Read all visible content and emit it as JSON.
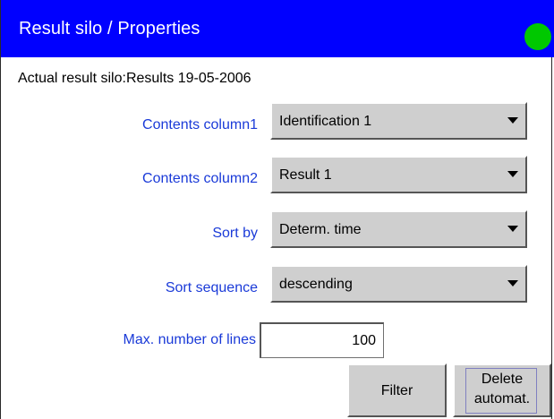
{
  "window": {
    "title": "Result silo / Properties",
    "status_color": "#00c800"
  },
  "actual_result_silo": "Actual result silo:Results 19-05-2006",
  "fields": [
    {
      "label": "Contents column1",
      "value": "Identification 1"
    },
    {
      "label": "Contents column2",
      "value": "Result 1"
    },
    {
      "label": "Sort by",
      "value": "Determ. time"
    },
    {
      "label": "Sort sequence",
      "value": "descending"
    }
  ],
  "max_lines": {
    "label": "Max. number of lines",
    "value": "100"
  },
  "buttons": {
    "filter": "Filter",
    "delete_line1": "Delete",
    "delete_line2": "automat."
  },
  "colors": {
    "titlebar": "#0000ff",
    "label_text": "#1a3ad8",
    "control_bg": "#cfcfcf"
  },
  "icons": {
    "dropdown": "chevron-down-icon",
    "status": "status-indicator-icon"
  }
}
